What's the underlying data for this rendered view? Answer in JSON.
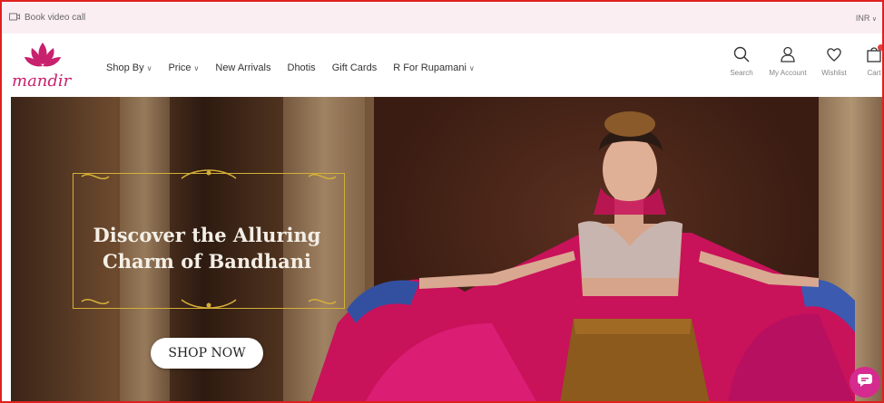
{
  "topbar": {
    "book_video_call": "Book video call",
    "currency": "INR"
  },
  "logo": {
    "text": "mandir",
    "color": "#c8216e"
  },
  "nav": {
    "items": [
      {
        "label": "Shop By",
        "dropdown": true
      },
      {
        "label": "Price",
        "dropdown": true
      },
      {
        "label": "New Arrivals",
        "dropdown": false
      },
      {
        "label": "Dhotis",
        "dropdown": false
      },
      {
        "label": "Gift Cards",
        "dropdown": false
      },
      {
        "label": "R For Rupamani",
        "dropdown": true
      }
    ]
  },
  "header_icons": {
    "search": "Search",
    "account": "My Account",
    "wishlist": "Wishlist",
    "cart": "Cart"
  },
  "hero": {
    "title_line1": "Discover the Alluring",
    "title_line2": "Charm of Bandhani",
    "cta": "SHOP NOW"
  },
  "colors": {
    "brand": "#c8216e",
    "topbar_bg": "#fbeef3",
    "gold": "#d4af37",
    "chat": "#d52b8f"
  }
}
